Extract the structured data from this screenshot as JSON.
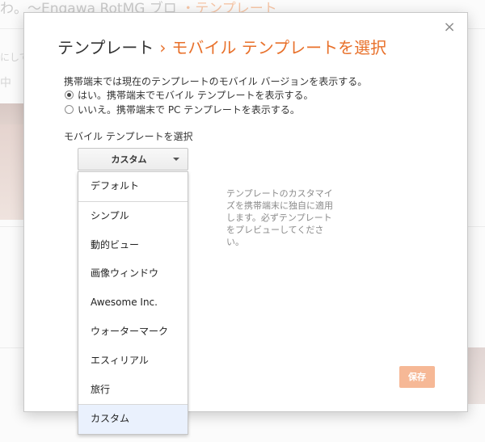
{
  "background": {
    "title_text": "わ。〜Engawa RotMG ブロ",
    "title_accent": "・テンプレート",
    "side_text_1": "にして",
    "side_text_2": "中"
  },
  "dialog": {
    "title_root": "テンプレート",
    "title_separator": "›",
    "title_current": "モバイル テンプレートを選択",
    "close_glyph": "×",
    "intro": "携帯端末では現在のテンプレートのモバイル バージョンを表示する。",
    "radio_options": [
      {
        "label": "はい。携帯端末でモバイル テンプレートを表示する。",
        "checked": true
      },
      {
        "label": "いいえ。携帯端末で PC テンプレートを表示する。",
        "checked": false
      }
    ],
    "select_label": "モバイル テンプレートを選択",
    "select_value": "カスタム",
    "menu": {
      "groups": [
        [
          "デフォルト"
        ],
        [
          "シンプル",
          "動的ビュー",
          "画像ウィンドウ",
          "Awesome Inc.",
          "ウォーターマーク",
          "エスィリアル",
          "旅行"
        ],
        [
          "カスタム"
        ]
      ],
      "selected": "カスタム"
    },
    "help_text": "テンプレートのカスタマイズを携帯端末に独自に適用します。必ずテンプレートをプレビューしてください。",
    "save_label": "保存"
  },
  "colors": {
    "accent": "#e8702a",
    "save_button": "#f6b896",
    "selected_item_bg": "#eaf1fd"
  }
}
